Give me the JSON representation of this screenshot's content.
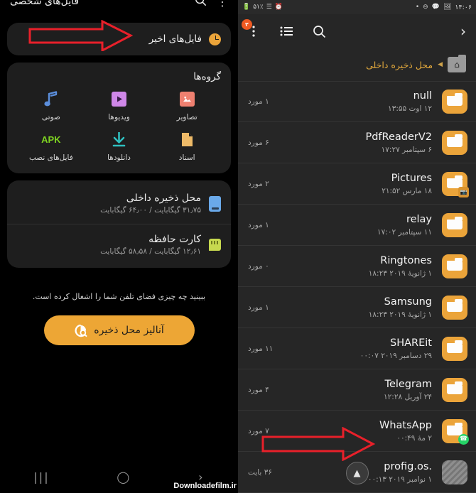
{
  "status_bar": {
    "battery": "۵۱٪",
    "signal_icon": "signal-bars-icon",
    "alarm_icon": "alarm-icon",
    "battery_icon": "battery-icon",
    "dot_icon": "dot-icon",
    "mute_icon": "mute-icon",
    "message_icon": "message-icon",
    "image_icon": "gallery-icon",
    "time": "۱۴:۰۶"
  },
  "left_panel": {
    "toolbar": {
      "overflow_badge": "۲",
      "overflow_icon": "more-vertical-icon",
      "list_icon": "list-view-icon",
      "search_icon": "search-icon",
      "forward_icon": "chevron-right-icon"
    },
    "breadcrumb": {
      "home_icon": "home-folder-icon",
      "caret_icon": "caret-left-icon",
      "path": "محل ذخیره داخلی"
    },
    "files": [
      {
        "name": "null",
        "date": "۱۲ اوت ۱۳:۵۵",
        "count": "۱ مورد",
        "icon": "folder-icon",
        "badge": ""
      },
      {
        "name": "PdfReaderV2",
        "date": "۶ سپتامبر ۱۷:۲۷",
        "count": "۶ مورد",
        "icon": "folder-icon",
        "badge": ""
      },
      {
        "name": "Pictures",
        "date": "۱۸ مارس ۲۱:۵۲",
        "count": "۲ مورد",
        "icon": "folder-icon",
        "badge": "image"
      },
      {
        "name": "relay",
        "date": "۱۱ سپتامبر ۱۷:۰۲",
        "count": "۱ مورد",
        "icon": "folder-icon",
        "badge": ""
      },
      {
        "name": "Ringtones",
        "date": "۱ ژانویهٔ ۲۰۱۹ ۱۸:۲۳",
        "count": "۰ مورد",
        "icon": "folder-icon",
        "badge": ""
      },
      {
        "name": "Samsung",
        "date": "۱ ژانویهٔ ۲۰۱۹ ۱۸:۲۳",
        "count": "۱ مورد",
        "icon": "folder-icon",
        "badge": ""
      },
      {
        "name": "SHAREit",
        "date": "۲۹ دسامبر ۲۰۱۹ ۰۰:۰۷",
        "count": "۱۱ مورد",
        "icon": "folder-icon",
        "badge": ""
      },
      {
        "name": "Telegram",
        "date": "۲۴ آوریل ۱۲:۲۸",
        "count": "۴ مورد",
        "icon": "folder-icon",
        "badge": ""
      },
      {
        "name": "WhatsApp",
        "date": "۲ مهٔ ۰۰:۴۹",
        "count": "۷ مورد",
        "icon": "folder-icon",
        "badge": "whatsapp"
      },
      {
        "name": ".profig.os",
        "date": "۱ نوامبر ۲۰۱۹ ۰۰:۱۳",
        "count": "۳۶ بایت",
        "icon": "file-hidden-icon",
        "badge": ""
      }
    ],
    "scroll_top_icon": "scroll-to-top-icon"
  },
  "right_panel": {
    "header": {
      "title": "فایل‌های شخصی",
      "search_icon": "search-icon",
      "overflow_icon": "more-vertical-icon"
    },
    "recent": {
      "label": "فایل‌های اخیر",
      "icon": "recent-clock-icon"
    },
    "groups": {
      "title": "گروه‌ها",
      "items": [
        {
          "label": "تصاویر",
          "icon": "image-category-icon",
          "color": "#ef8070"
        },
        {
          "label": "ویدیوها",
          "icon": "video-category-icon",
          "color": "#cf87e8"
        },
        {
          "label": "صوتی",
          "icon": "audio-category-icon",
          "color": "#5b8edb"
        },
        {
          "label": "اسناد",
          "icon": "document-category-icon",
          "color": "#eeba68"
        },
        {
          "label": "دانلودها",
          "icon": "download-category-icon",
          "color": "#2fbfbf"
        },
        {
          "label": "فایل‌های نصب",
          "icon": "apk-category-icon",
          "color": "#7ed321",
          "text": "APK"
        }
      ]
    },
    "storage": [
      {
        "name": "محل ذخیره داخلی",
        "detail": "۳۱٫۷۵ گیگابایت / ۶۴٫۰۰ گیگابایت",
        "icon": "internal-storage-icon"
      },
      {
        "name": "کارت حافظه",
        "detail": "۱۲٫۶۱ گیگابایت / ۵۸٫۵۸ گیگابایت",
        "icon": "sd-card-icon"
      }
    ],
    "analyze": {
      "note": "ببینید چه چیزی فضای تلفن شما را اشغال کرده است.",
      "button_label": "آنالیز محل ذخیره",
      "button_icon": "storage-analysis-icon",
      "button_color": "#eda635"
    },
    "navbar": {
      "recents_icon": "recents-nav-icon",
      "home_icon": "home-nav-icon",
      "back_icon": "back-nav-icon"
    },
    "watermark": "Downloadefilm.ir"
  },
  "annotations": {
    "arrow_storage_color": "#e8202a",
    "arrow_whatsapp_color": "#e8202a"
  }
}
